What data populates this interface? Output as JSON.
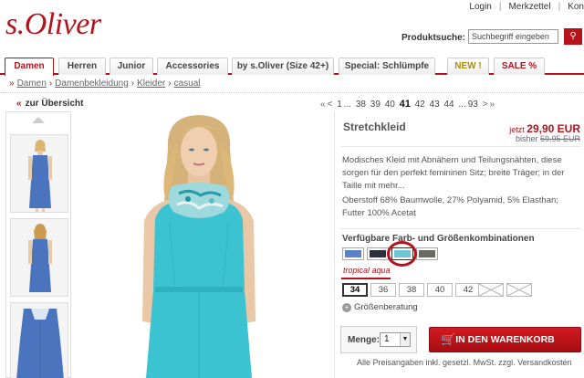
{
  "header": {
    "logo": "s.Oliver",
    "links": [
      "Login",
      "Merkzettel",
      "Kon"
    ],
    "search_label": "Produktsuche:",
    "search_placeholder": "Suchbegriff eingeben"
  },
  "nav": {
    "tabs": [
      "Damen",
      "Herren",
      "Junior",
      "Accessories",
      "by s.Oliver (Size 42+)",
      "Special: Schlümpfe",
      "NEW !",
      "SALE %"
    ],
    "active": "Damen"
  },
  "breadcrumb": [
    "Damen",
    "Damenbekleidung",
    "Kleider",
    "casual"
  ],
  "back_link": "zur Übersicht",
  "pager": {
    "first": "«",
    "prev": "<",
    "pages_start": "1",
    "ellipsis": "...",
    "pages": [
      "38",
      "39",
      "40",
      "41",
      "42",
      "43",
      "44"
    ],
    "current": "41",
    "last": "93",
    "next": ">",
    "end": "»"
  },
  "product": {
    "title": "Stretchkleid",
    "price_prefix": "jetzt",
    "price_now": "29,90 EUR",
    "price_was_prefix": "bisher",
    "price_was": "59,95 EUR",
    "description": "Modisches Kleid mit Abnähern und Teilungsnähten, diese sorgen für den perfekt femininen Sitz; breite Träger; in der Taille mit mehr...",
    "fabric": "Oberstoff 68% Baumwolle, 27% Polyamid, 5% Elasthan; Futter 100% Acetat",
    "variants_heading": "Verfügbare Farb- und Größenkombinationen",
    "colors": [
      "#5a82c4",
      "#2b2f3e",
      "#6cc7d2",
      "#6a6a5e"
    ],
    "selected_color_name": "tropical aqua",
    "sizes": [
      "34",
      "36",
      "38",
      "40",
      "42",
      "",
      ""
    ],
    "selected_size": "34",
    "size_guide": "Größenberatung",
    "qty_label": "Menge:",
    "qty_value": "1",
    "cart_button": "IN DEN WARENKORB",
    "vat_note": "Alle Preisangaben inkl. gesetzl. MwSt. zzgl. Versandkosten"
  }
}
